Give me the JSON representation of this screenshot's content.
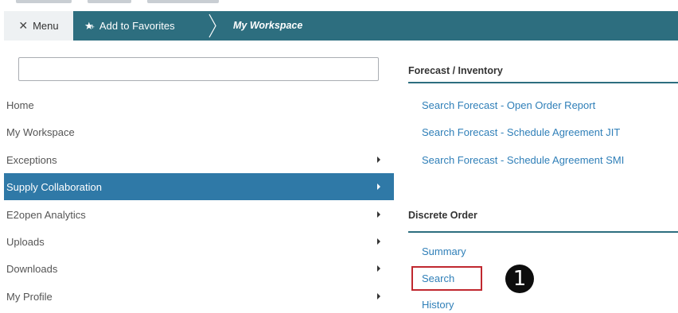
{
  "topbar": {
    "menu_icon": "close-icon",
    "menu_label": "Menu",
    "favorites_icon": "star-add-icon",
    "favorites_label": "Add to Favorites",
    "workspace_label": "My Workspace"
  },
  "search": {
    "value": "",
    "placeholder": ""
  },
  "nav": {
    "items": [
      {
        "label": "Home",
        "has_arrow": false,
        "active": false
      },
      {
        "label": "My Workspace",
        "has_arrow": false,
        "active": false
      },
      {
        "label": "Exceptions",
        "has_arrow": true,
        "active": false
      },
      {
        "label": "Supply Collaboration",
        "has_arrow": true,
        "active": true
      },
      {
        "label": "E2open Analytics",
        "has_arrow": true,
        "active": false
      },
      {
        "label": "Uploads",
        "has_arrow": true,
        "active": false
      },
      {
        "label": "Downloads",
        "has_arrow": true,
        "active": false
      },
      {
        "label": "My Profile",
        "has_arrow": true,
        "active": false
      }
    ]
  },
  "sections": {
    "forecast": {
      "title": "Forecast / Inventory",
      "links": [
        "Search Forecast - Open Order Report",
        "Search Forecast - Schedule Agreement JIT",
        "Search Forecast - Schedule Agreement SMI"
      ]
    },
    "discrete": {
      "title": "Discrete Order",
      "links": [
        "Summary",
        "Search",
        "History"
      ]
    }
  },
  "annotation": {
    "step_number": "1"
  },
  "colors": {
    "topbar": "#2d6e7f",
    "active_nav": "#2f79a7",
    "link": "#2f7fb8",
    "highlight": "#c0282f"
  }
}
